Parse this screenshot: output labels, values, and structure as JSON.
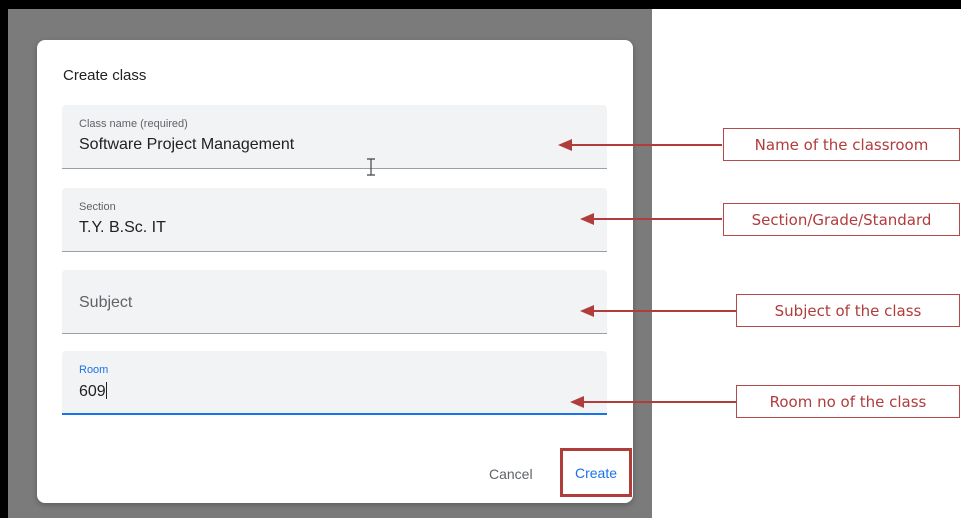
{
  "dialog": {
    "title": "Create class",
    "fields": [
      {
        "label": "Class name (required)",
        "value": "Software Project Management"
      },
      {
        "label": "Section",
        "value": "T.Y. B.Sc. IT"
      },
      {
        "placeholder": "Subject",
        "value": ""
      },
      {
        "label": "Room",
        "value": "609"
      }
    ],
    "cancel_label": "Cancel",
    "create_label": "Create"
  },
  "callouts": [
    {
      "text": "Name of the classroom"
    },
    {
      "text": "Section/Grade/Standard"
    },
    {
      "text": "Subject of the class"
    },
    {
      "text": "Room no of the class"
    }
  ],
  "colors": {
    "annotation": "#b03c3c",
    "accent": "#1a73e8",
    "field_bg": "#f1f3f4",
    "backdrop": "#7b7b7b"
  },
  "cursor_icon": "text-cursor-icon",
  "arrow_icon": "left-arrow-icon"
}
